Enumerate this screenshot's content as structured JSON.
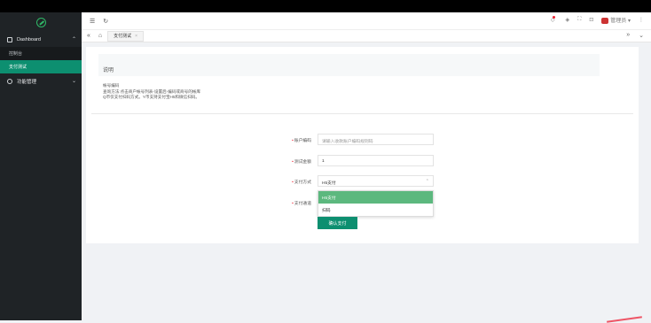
{
  "sidebar": {
    "group1": {
      "label": "Dashboard",
      "items": [
        "控制台",
        "支付测试"
      ]
    },
    "group2": {
      "label": "功能管理"
    }
  },
  "header": {
    "user_name": "管理员"
  },
  "tabs": {
    "active_tab": "支付测试"
  },
  "notice": {
    "title": "说明"
  },
  "description": {
    "line1": "帐号编码",
    "line2": "查询方法:点击商户帐号列表-设置后-编码或商号的帐库",
    "line3": "Q币仅支付扫码方式。Y币支持支付宝H5和微信扫码。"
  },
  "form": {
    "account": {
      "label": "账户编码",
      "placeholder": "请输入收款账户编码规则码"
    },
    "amount": {
      "label": "测试金额",
      "value": "1"
    },
    "method": {
      "label": "支付方式",
      "value": "H5支付",
      "options": [
        "H5支付",
        "扫码"
      ]
    },
    "channel": {
      "label": "支付通道"
    },
    "submit_label": "确认支付"
  },
  "colors": {
    "primary": "#0d8f70",
    "option_highlight": "#5cb87e",
    "sidebar": "#1f2326"
  }
}
